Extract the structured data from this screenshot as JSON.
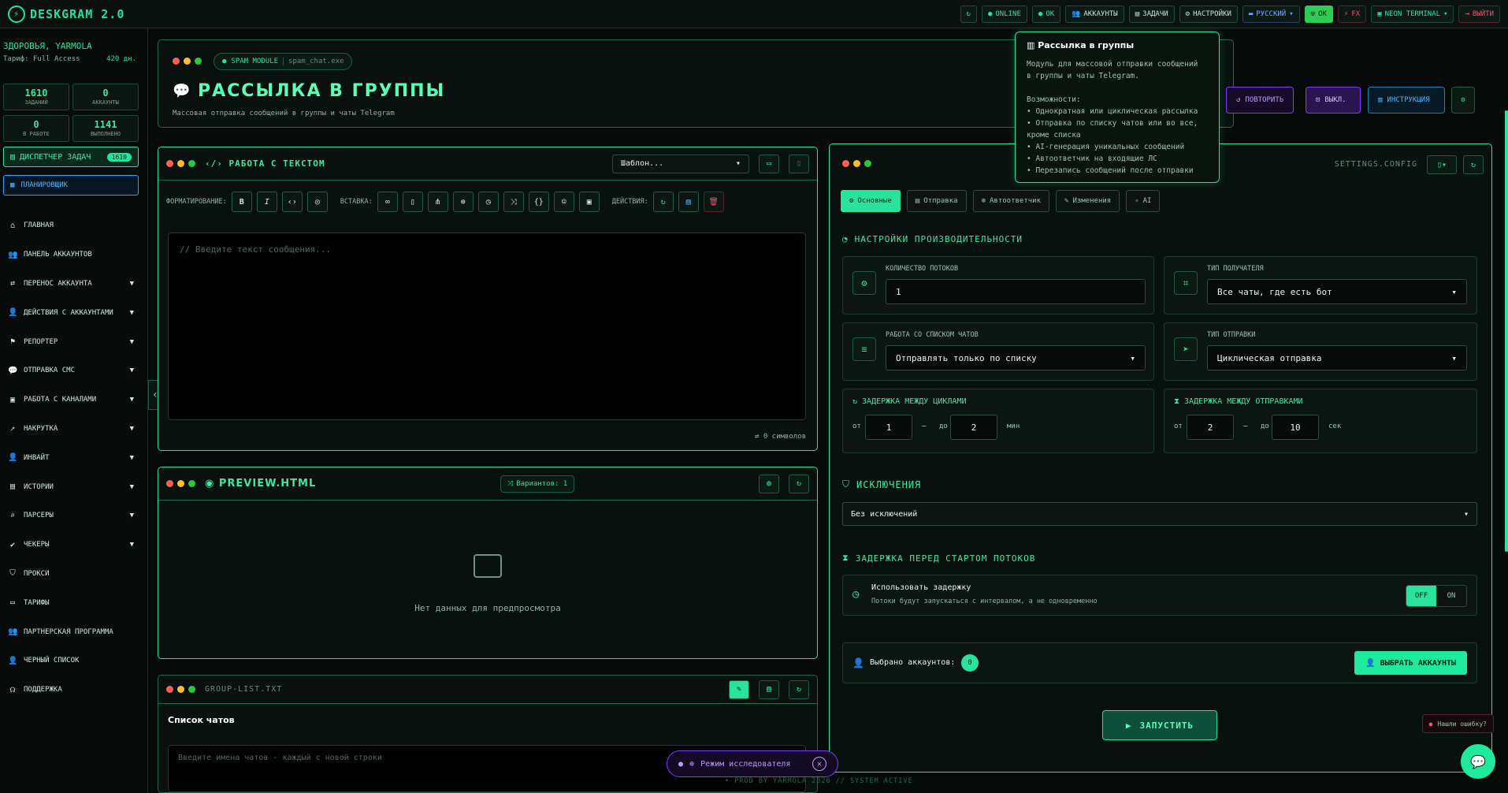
{
  "app": {
    "title": "DESKGRAM 2.0"
  },
  "topbar": {
    "online": "ONLINE",
    "ok": "OK",
    "accounts": "АККАУНТЫ",
    "tasks": "ЗАДАЧИ",
    "settings": "НАСТРОЙКИ",
    "language": "РУССКИЙ",
    "status": "OK",
    "fx": "FX",
    "theme": "NEON TERMINAL",
    "logout": "ВЫЙТИ"
  },
  "sidebar": {
    "user": "ЗДОРОВЬЯ, YARMOLA",
    "tariff": "Тариф: Full Access",
    "balance": "420 дн.",
    "stats": [
      {
        "value": "1610",
        "label": "ЗАДАНИЙ"
      },
      {
        "value": "0",
        "label": "АККАУНТЫ"
      },
      {
        "value": "0",
        "label": "В РАБОТЕ"
      },
      {
        "value": "1141",
        "label": "ВЫПОЛНЕНО"
      }
    ],
    "dispatcher": {
      "label": "ДИСПЕТЧЕР ЗАДАЧ",
      "count": "1610"
    },
    "planner": "ПЛАНИРОВЩИК",
    "items": [
      {
        "label": "ГЛАВНАЯ",
        "icon": "home-icon",
        "expandable": false
      },
      {
        "label": "ПАНЕЛЬ АККАУНТОВ",
        "icon": "users-icon",
        "expandable": false
      },
      {
        "label": "ПЕРЕНОС АККАУНТА",
        "icon": "transfer-icon",
        "expandable": true
      },
      {
        "label": "ДЕЙСТВИЯ С АККАУНТАМИ",
        "icon": "user-actions-icon",
        "expandable": true
      },
      {
        "label": "РЕПОРТЕР",
        "icon": "flag-icon",
        "expandable": true
      },
      {
        "label": "ОТПРАВКА СМС",
        "icon": "message-icon",
        "expandable": true
      },
      {
        "label": "РАБОТА С КАНАЛАМИ",
        "icon": "briefcase-icon",
        "expandable": true
      },
      {
        "label": "НАКРУТКА",
        "icon": "chart-icon",
        "expandable": true
      },
      {
        "label": "ИНВАЙТ",
        "icon": "invite-icon",
        "expandable": true
      },
      {
        "label": "ИСТОРИИ",
        "icon": "stories-icon",
        "expandable": true
      },
      {
        "label": "ПАРСЕРЫ",
        "icon": "search-icon",
        "expandable": true
      },
      {
        "label": "ЧЕКЕРЫ",
        "icon": "check-icon",
        "expandable": true
      },
      {
        "label": "ПРОКСИ",
        "icon": "shield-icon",
        "expandable": false
      },
      {
        "label": "ТАРИФЫ",
        "icon": "card-icon",
        "expandable": false
      },
      {
        "label": "ПАРТНЕРСКАЯ ПРОГРАММА",
        "icon": "partners-icon",
        "expandable": false
      },
      {
        "label": "ЧЕРНЫЙ СПИСОК",
        "icon": "blacklist-icon",
        "expandable": false
      },
      {
        "label": "ПОДДЕРЖКА",
        "icon": "headset-icon",
        "expandable": false
      }
    ]
  },
  "header": {
    "module": "SPAM MODULE",
    "module_file": "spam_chat.exe",
    "title": "РАССЫЛКА В ГРУППЫ",
    "subtitle": "Массовая отправка сообщений в группы и чаты Telegram",
    "repeat": "ПОВТОРИТЬ",
    "off": "ВЫКЛ.",
    "instruction": "ИНСТРУКЦИЯ"
  },
  "tooltip": {
    "title": "Рассылка в группы",
    "lines": [
      "Модуль для массовой отправки сообщений",
      "в группы и чаты Telegram.",
      "",
      "Возможности:",
      "• Однократная или циклическая рассылка",
      "• Отправка по списку чатов или во все,",
      "кроме списка",
      "• AI-генерация уникальных сообщений",
      "• Автоответчик на входящие ЛС",
      "• Перезапись сообщений после отправки"
    ]
  },
  "text_panel": {
    "title": "РАБОТА С ТЕКСТОМ",
    "template": "Шаблон...",
    "format_label": "ФОРМАТИРОВАНИЕ:",
    "insert_label": "ВСТАВКА:",
    "actions_label": "ДЕЙСТВИЯ:",
    "bold": "B",
    "italic": "I",
    "placeholder": "// Введите текст сообщения...",
    "chars": "0 символов"
  },
  "preview_panel": {
    "title": "PREVIEW.HTML",
    "variants": "Вариантов: 1",
    "empty": "Нет данных для предпросмотра"
  },
  "group_panel": {
    "file": "GROUP-LIST.TXT",
    "title": "Список чатов",
    "placeholder": "Введите имена чатов - каждый с новой строки"
  },
  "settings_panel": {
    "file": "SETTINGS.CONFIG",
    "tabs": [
      "Основные",
      "Отправка",
      "Автоответчик",
      "Изменения",
      "AI"
    ],
    "perf_title": "НАСТРОЙКИ ПРОИЗВОДИТЕЛЬНОСТИ",
    "threads_label": "КОЛИЧЕСТВО ПОТОКОВ",
    "threads_value": "1",
    "recipient_label": "ТИП ПОЛУЧАТЕЛЯ",
    "recipient_value": "Все чаты, где есть бот",
    "chatlist_label": "РАБОТА СО СПИСКОМ ЧАТОВ",
    "chatlist_value": "Отправлять только по списку",
    "sendtype_label": "ТИП ОТПРАВКИ",
    "sendtype_value": "Циклическая отправка",
    "cycle_delay_title": "ЗАДЕРЖКА МЕЖДУ ЦИКЛАМИ",
    "cycle_from": "1",
    "cycle_to": "2",
    "cycle_unit": "мин",
    "send_delay_title": "ЗАДЕРЖКА МЕЖДУ ОТПРАВКАМИ",
    "send_from": "2",
    "send_to": "10",
    "send_unit": "сек",
    "from": "от",
    "to": "до",
    "exclusions_title": "ИСКЛЮЧЕНИЯ",
    "exclusions_value": "Без исключений",
    "start_delay_title": "ЗАДЕРЖКА ПЕРЕД СТАРТОМ ПОТОКОВ",
    "use_delay": "Использовать задержку",
    "use_delay_hint": "Потоки будут запускаться с интервалом, а не одновременно",
    "toggle_off": "OFF",
    "toggle_on": "ON",
    "selected_accounts": "Выбрано аккаунтов:",
    "selected_count": "0",
    "pick_accounts": "ВЫБРАТЬ АККАУНТЫ",
    "launch": "ЗАПУСТИТЬ"
  },
  "floating": {
    "research": "Режим исследователя",
    "bug": "Нашли ошибку?",
    "footer": "• PROD BY YARMOLA 2026  // SYSTEM ACTIVE"
  }
}
